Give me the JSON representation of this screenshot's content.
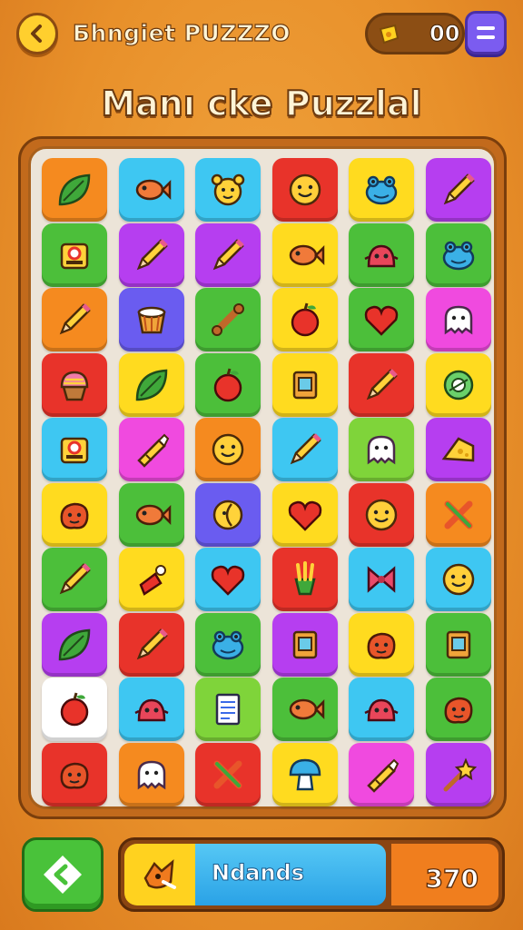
{
  "header": {
    "title": "Бhngiet PUZZZO",
    "coins": "00",
    "back_icon": "chevron-left-icon",
    "menu_icon": "menu-icon"
  },
  "game_title": "Manı cke Puzzlal",
  "colors": {
    "green": "#4cbf3a",
    "blue": "#3ec7f2",
    "yellow": "#ffdb1f",
    "red": "#e8332a",
    "purple": "#b63ef0",
    "orange": "#f58a1f",
    "indigo": "#6a5cf0",
    "magenta": "#f04adf",
    "lime": "#7fd43a",
    "white": "#ffffff",
    "board_bg": "#ece4d8"
  },
  "grid": [
    [
      {
        "c": "orange",
        "i": "leaf"
      },
      {
        "c": "blue",
        "i": "fish"
      },
      {
        "c": "blue",
        "i": "bear-face"
      },
      {
        "c": "red",
        "i": "smiley-face"
      },
      {
        "c": "yellow",
        "i": "frog-face"
      },
      {
        "c": "purple",
        "i": "pencil"
      }
    ],
    [
      {
        "c": "green",
        "i": "robot"
      },
      {
        "c": "purple",
        "i": "pencil"
      },
      {
        "c": "purple",
        "i": "pencil"
      },
      {
        "c": "yellow",
        "i": "fish"
      },
      {
        "c": "green",
        "i": "monster"
      },
      {
        "c": "green",
        "i": "frog-face"
      }
    ],
    [
      {
        "c": "orange",
        "i": "pencil"
      },
      {
        "c": "indigo",
        "i": "drum"
      },
      {
        "c": "green",
        "i": "bone"
      },
      {
        "c": "yellow",
        "i": "apple"
      },
      {
        "c": "green",
        "i": "heart"
      },
      {
        "c": "magenta",
        "i": "ghost"
      }
    ],
    [
      {
        "c": "red",
        "i": "cupcake"
      },
      {
        "c": "yellow",
        "i": "leaf"
      },
      {
        "c": "green",
        "i": "apple"
      },
      {
        "c": "yellow",
        "i": "box"
      },
      {
        "c": "red",
        "i": "pencil"
      },
      {
        "c": "yellow",
        "i": "ring"
      }
    ],
    [
      {
        "c": "blue",
        "i": "robot"
      },
      {
        "c": "magenta",
        "i": "crayon"
      },
      {
        "c": "orange",
        "i": "smiley-face"
      },
      {
        "c": "blue",
        "i": "pencil"
      },
      {
        "c": "lime",
        "i": "ghost"
      },
      {
        "c": "purple",
        "i": "cheese"
      }
    ],
    [
      {
        "c": "yellow",
        "i": "blob"
      },
      {
        "c": "green",
        "i": "fish"
      },
      {
        "c": "indigo",
        "i": "moon-face"
      },
      {
        "c": "yellow",
        "i": "heart"
      },
      {
        "c": "red",
        "i": "smiley-face"
      },
      {
        "c": "orange",
        "i": "cross-tools"
      }
    ],
    [
      {
        "c": "green",
        "i": "pencil"
      },
      {
        "c": "yellow",
        "i": "bottle"
      },
      {
        "c": "blue",
        "i": "heart"
      },
      {
        "c": "red",
        "i": "fries"
      },
      {
        "c": "blue",
        "i": "bow"
      },
      {
        "c": "blue",
        "i": "smiley-face"
      }
    ],
    [
      {
        "c": "purple",
        "i": "leaf"
      },
      {
        "c": "red",
        "i": "pencil"
      },
      {
        "c": "green",
        "i": "frog-face"
      },
      {
        "c": "purple",
        "i": "box"
      },
      {
        "c": "yellow",
        "i": "blob"
      },
      {
        "c": "green",
        "i": "box"
      }
    ],
    [
      {
        "c": "white",
        "i": "apple"
      },
      {
        "c": "blue",
        "i": "monster"
      },
      {
        "c": "lime",
        "i": "note"
      },
      {
        "c": "green",
        "i": "fish"
      },
      {
        "c": "blue",
        "i": "monster"
      },
      {
        "c": "green",
        "i": "blob"
      }
    ],
    [
      {
        "c": "red",
        "i": "blob"
      },
      {
        "c": "orange",
        "i": "ghost"
      },
      {
        "c": "red",
        "i": "cross-tools"
      },
      {
        "c": "yellow",
        "i": "mushroom"
      },
      {
        "c": "magenta",
        "i": "crayon"
      },
      {
        "c": "purple",
        "i": "wand"
      }
    ]
  ],
  "footer": {
    "hint_icon": "diamond-arrow-icon",
    "progress_label": "Ndands",
    "progress_icon": "fox-icon",
    "progress_fraction": 0.62,
    "score": "370"
  }
}
